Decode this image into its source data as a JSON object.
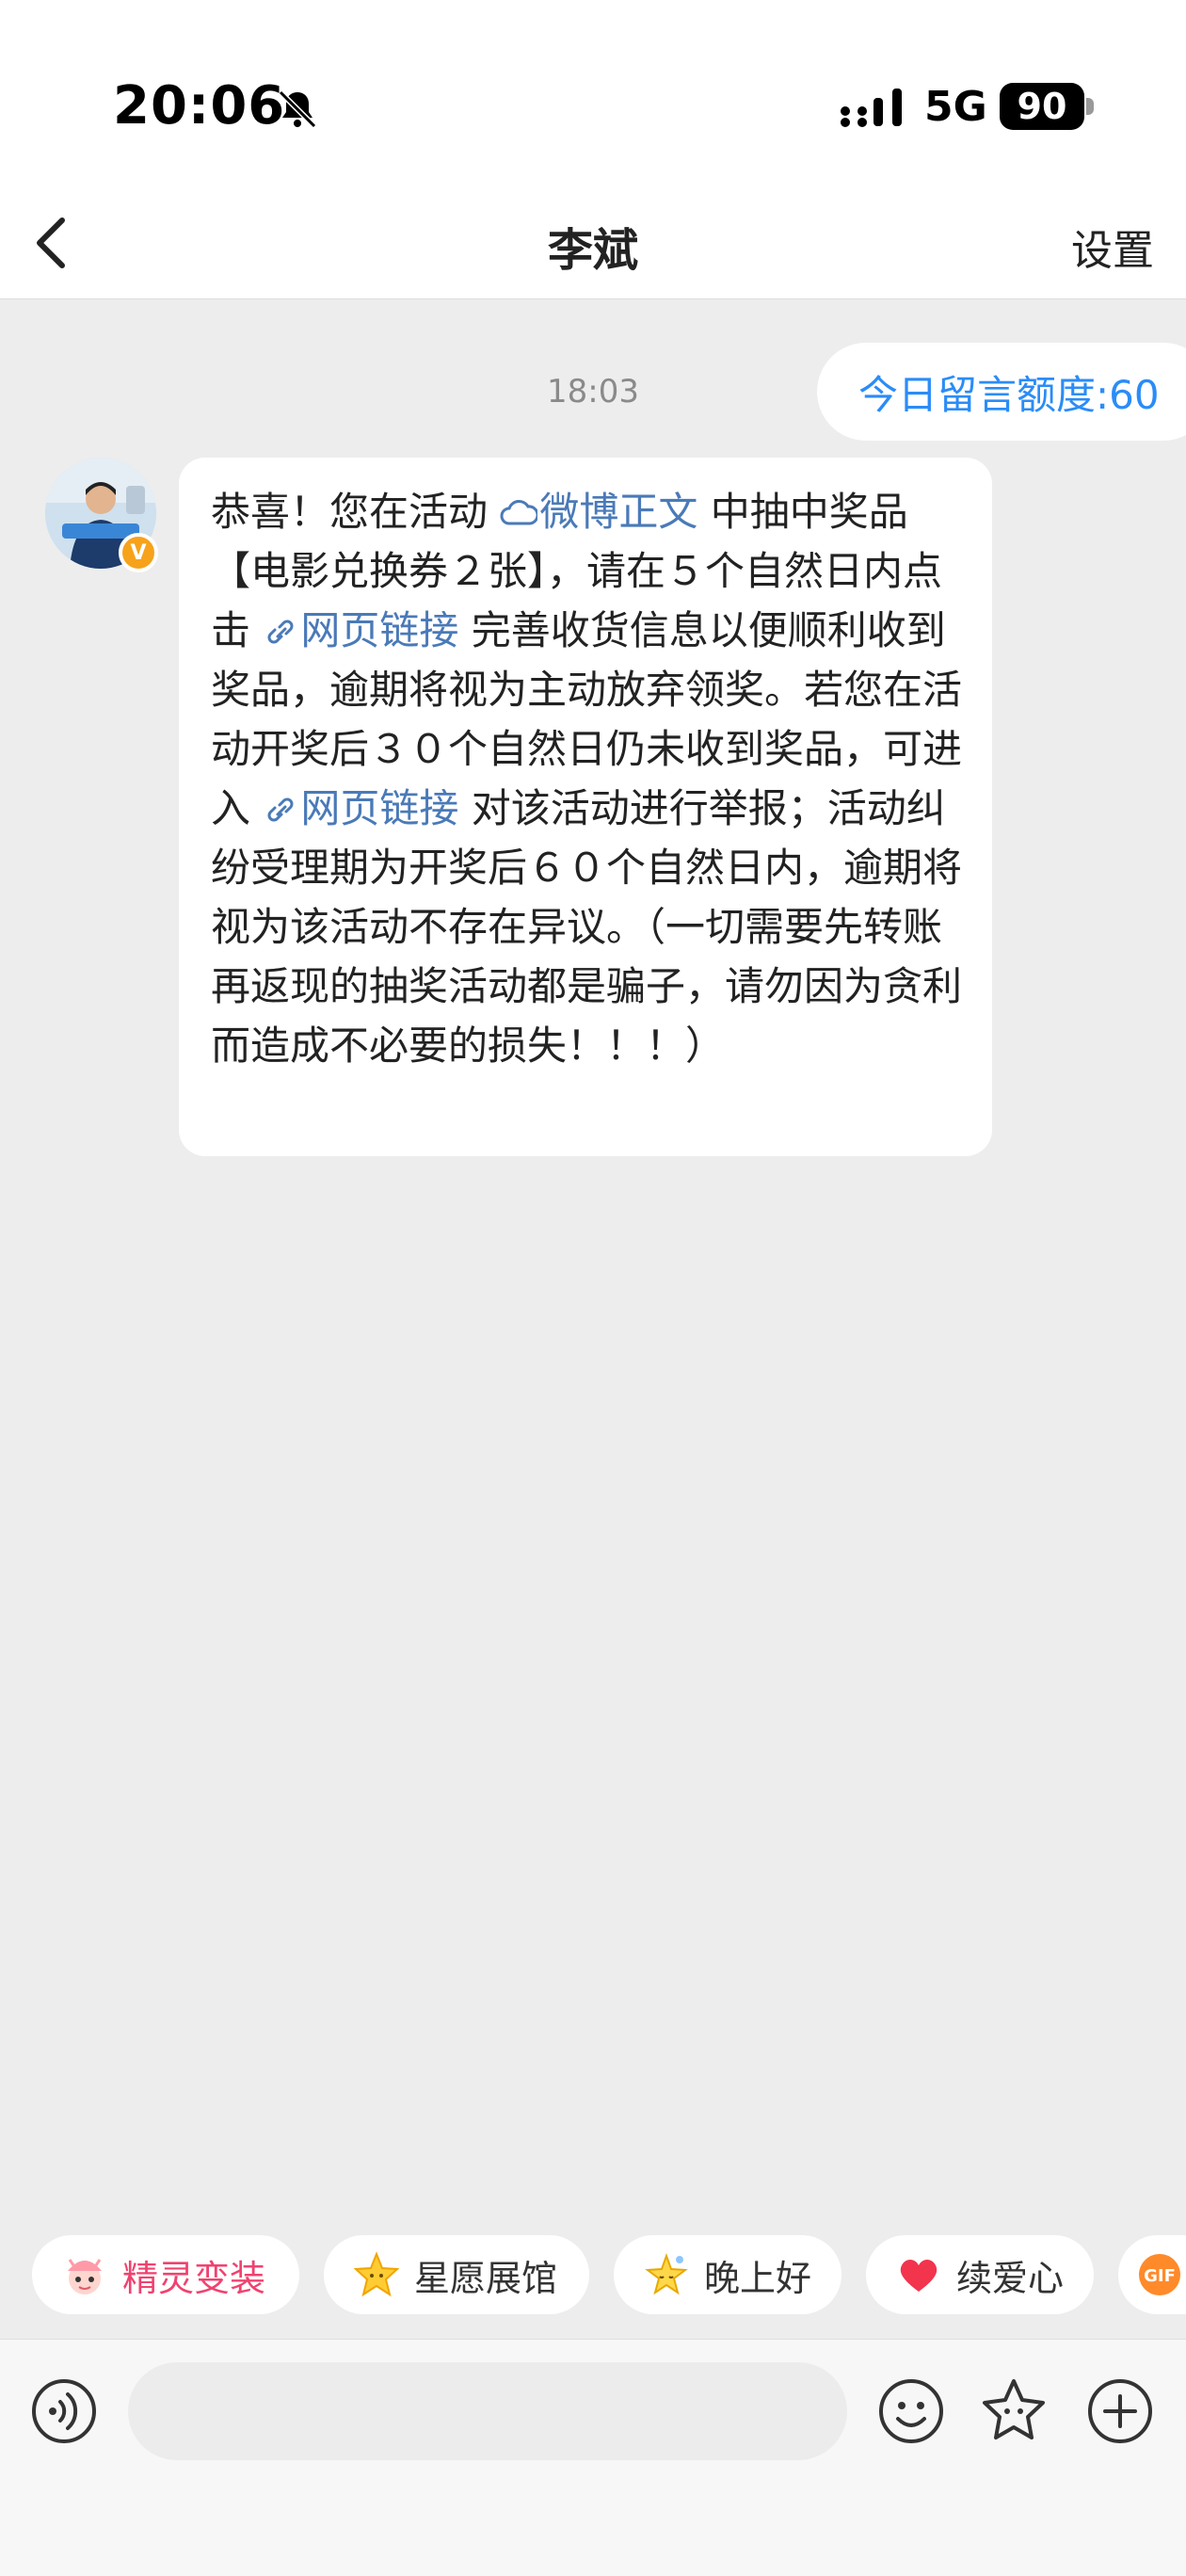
{
  "status_bar": {
    "time": "20:06",
    "network": "5G",
    "battery": "90",
    "icons": [
      "bell-muted-icon",
      "signal-icon"
    ]
  },
  "nav": {
    "title": "李斌",
    "settings_label": "设置",
    "back_icon": "chevron-left-icon"
  },
  "chat": {
    "timestamp": "18:03",
    "quota_notice": "今日留言额度:60",
    "message": {
      "seg1": "恭喜！您在活动 ",
      "link1": "微博正文",
      "seg2": " 中抽中奖品【电影兑换券２张】，请在５个自然日内点击 ",
      "link2": "网页链接",
      "seg3": " 完善收货信息以便顺利收到奖品，逾期将视为主动放弃领奖。若您在活动开奖后３０个自然日仍未收到奖品，可进入 ",
      "link3": "网页链接",
      "seg4": " 对该活动进行举报；活动纠纷受理期为开奖后６０个自然日内，逾期将视为该活动不存在异议。（一切需要先转账再返现的抽奖活动都是骗子，请勿因为贪利而造成不必要的损失！！！）"
    },
    "verified_badge": "V",
    "link_color": "#4a7ab8"
  },
  "quick_actions": [
    {
      "label": "精灵变装",
      "icon": "fairy-icon"
    },
    {
      "label": "星愿展馆",
      "icon": "star-icon"
    },
    {
      "label": "晚上好",
      "icon": "sleepy-star-icon"
    },
    {
      "label": "续爱心",
      "icon": "heart-icon"
    },
    {
      "label": "GIF",
      "icon": "gif-icon"
    }
  ],
  "input_bar": {
    "placeholder": "",
    "icons": [
      "voice-icon",
      "emoji-icon",
      "sticker-icon",
      "plus-icon"
    ]
  },
  "colors": {
    "accent_blue": "#2b8cf7",
    "background": "#ededed",
    "chip_pink": "#f0426f"
  }
}
